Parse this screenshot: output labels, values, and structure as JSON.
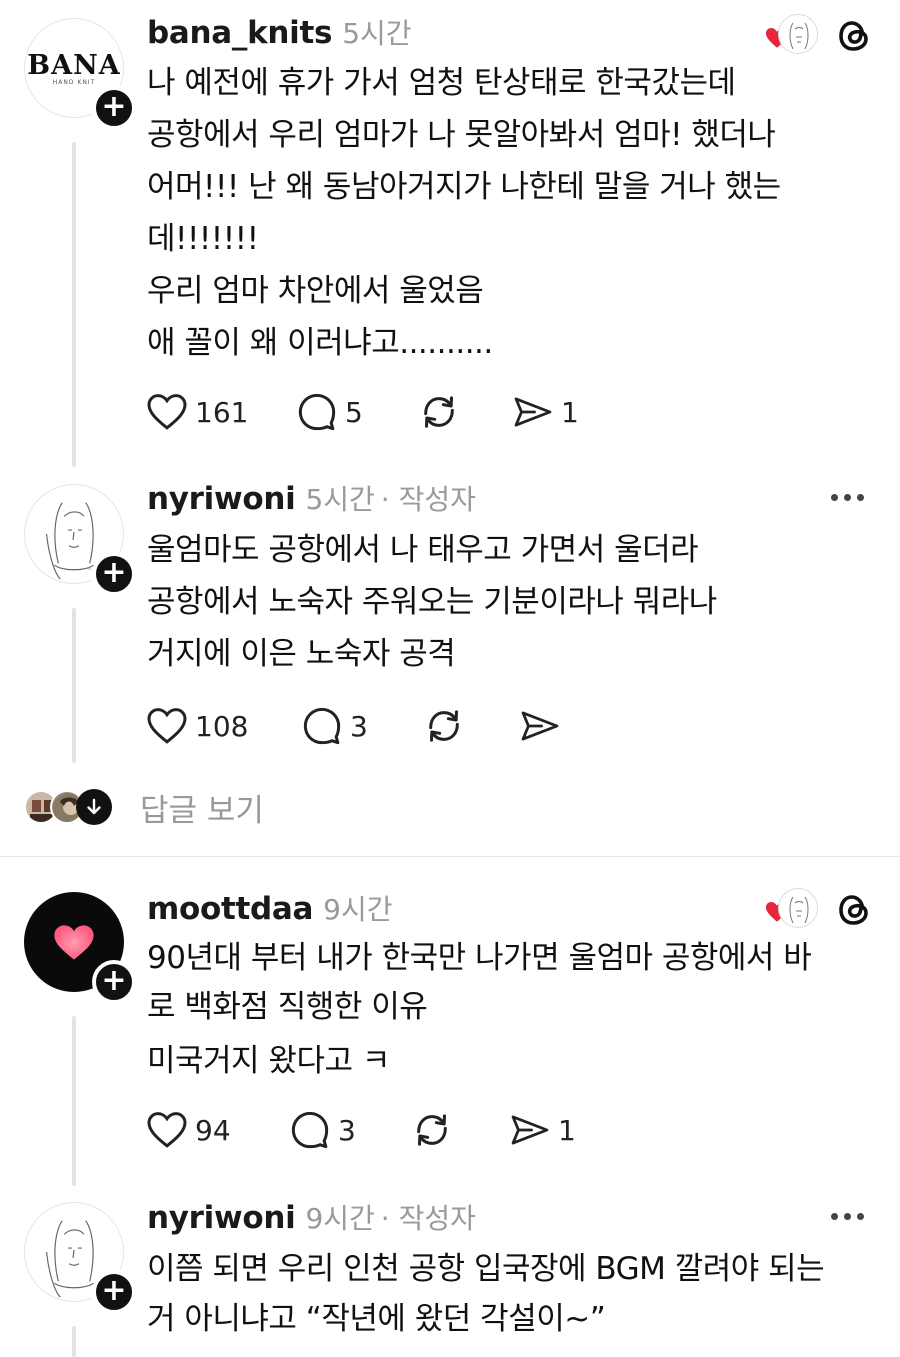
{
  "posts": [
    {
      "username": "bana_knits",
      "time": "5시간",
      "lines": [
        "나 예전에 휴가 가서 엄청 탄상태로 한국갔는데",
        "공항에서 우리 엄마가 나 못알아봐서 엄마! 했더나",
        "어머!!! 난 왜 동남아거지가 나한테 말을 거나 했는",
        "데!!!!!!!",
        "우리 엄마 차안에서 울었음",
        "애 꼴이 왜 이러냐고.........."
      ],
      "likes": "161",
      "replies": "5",
      "shares": "1",
      "avatar_text": "BANA",
      "avatar_subtext": "HAND KNIT"
    },
    {
      "username": "nyriwoni",
      "time": "5시간",
      "author_tag": "· 작성자",
      "lines": [
        "울엄마도 공항에서 나 태우고 가면서 울더라",
        "공항에서 노숙자 주워오는 기분이라나 뭐라나",
        "거지에 이은 노숙자 공격"
      ],
      "likes": "108",
      "replies": "3",
      "shares": ""
    },
    {
      "username": "moottdaa",
      "time": "9시간",
      "lines": [
        "90년대 부터 내가 한국만 나가면 울엄마 공항에서 바",
        "로 백화점 직행한 이유",
        "미국거지 왔다고 ㅋ"
      ],
      "likes": "94",
      "replies": "3",
      "shares": "1"
    },
    {
      "username": "nyriwoni",
      "time": "9시간",
      "author_tag": "· 작성자",
      "lines": [
        "이쯤 되면 우리 인천 공항 입국장에 BGM 깔려야 되는",
        "거 아니냐고 “작년에 왔던 각설이~”"
      ]
    }
  ],
  "view_replies_label": "답글 보기",
  "colors": {
    "heart_red": "#e8263b",
    "muted_text": "#9a9a9a",
    "thread_line": "#e3e3e3"
  },
  "icons": [
    "heart-icon",
    "comment-icon",
    "repost-icon",
    "share-icon",
    "threads-logo-icon",
    "more-icon",
    "plus-icon",
    "arrow-down-icon"
  ]
}
